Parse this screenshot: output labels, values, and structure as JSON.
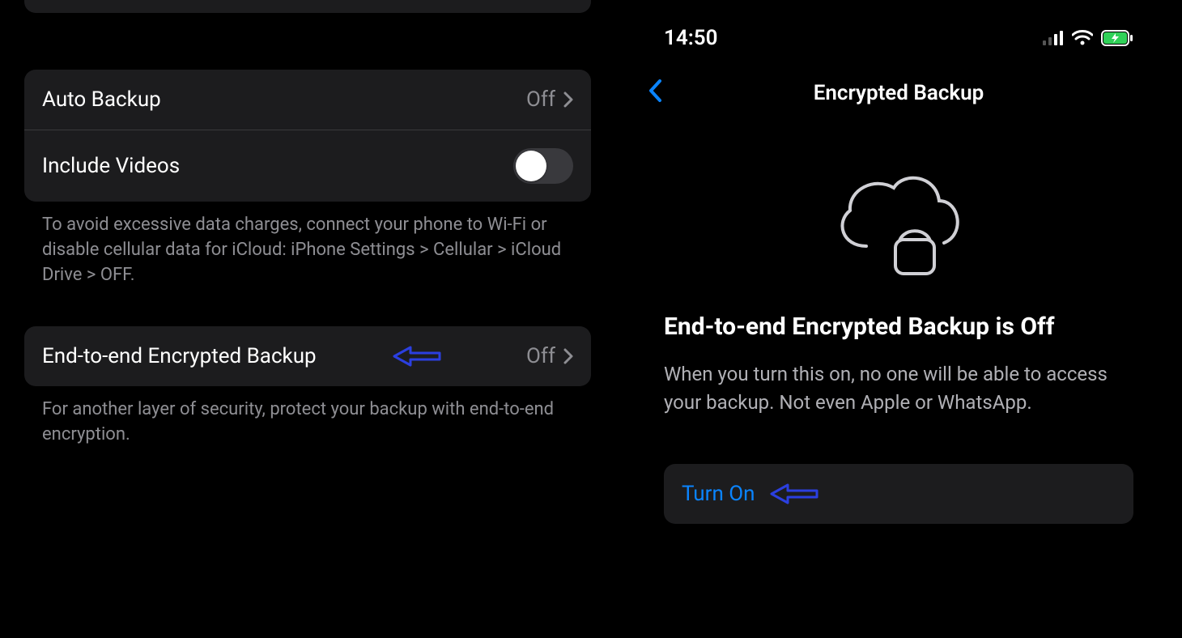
{
  "left": {
    "rows": {
      "auto_backup": {
        "label": "Auto Backup",
        "value": "Off"
      },
      "include_videos": {
        "label": "Include Videos",
        "toggle": "off"
      },
      "e2e": {
        "label": "End-to-end Encrypted Backup",
        "value": "Off"
      }
    },
    "footnotes": {
      "data_charges": "To avoid excessive data charges, connect your phone to Wi-Fi or disable cellular data for iCloud: iPhone Settings > Cellular > iCloud Drive > OFF.",
      "e2e": "For another layer of security, protect your backup with end-to-end encryption."
    }
  },
  "right": {
    "status": {
      "time": "14:50"
    },
    "nav": {
      "title": "Encrypted Backup"
    },
    "heading": "End-to-end Encrypted Backup is Off",
    "description": "When you turn this on, no one will be able to access your backup. Not even Apple or WhatsApp.",
    "action": {
      "turn_on": "Turn On"
    }
  }
}
